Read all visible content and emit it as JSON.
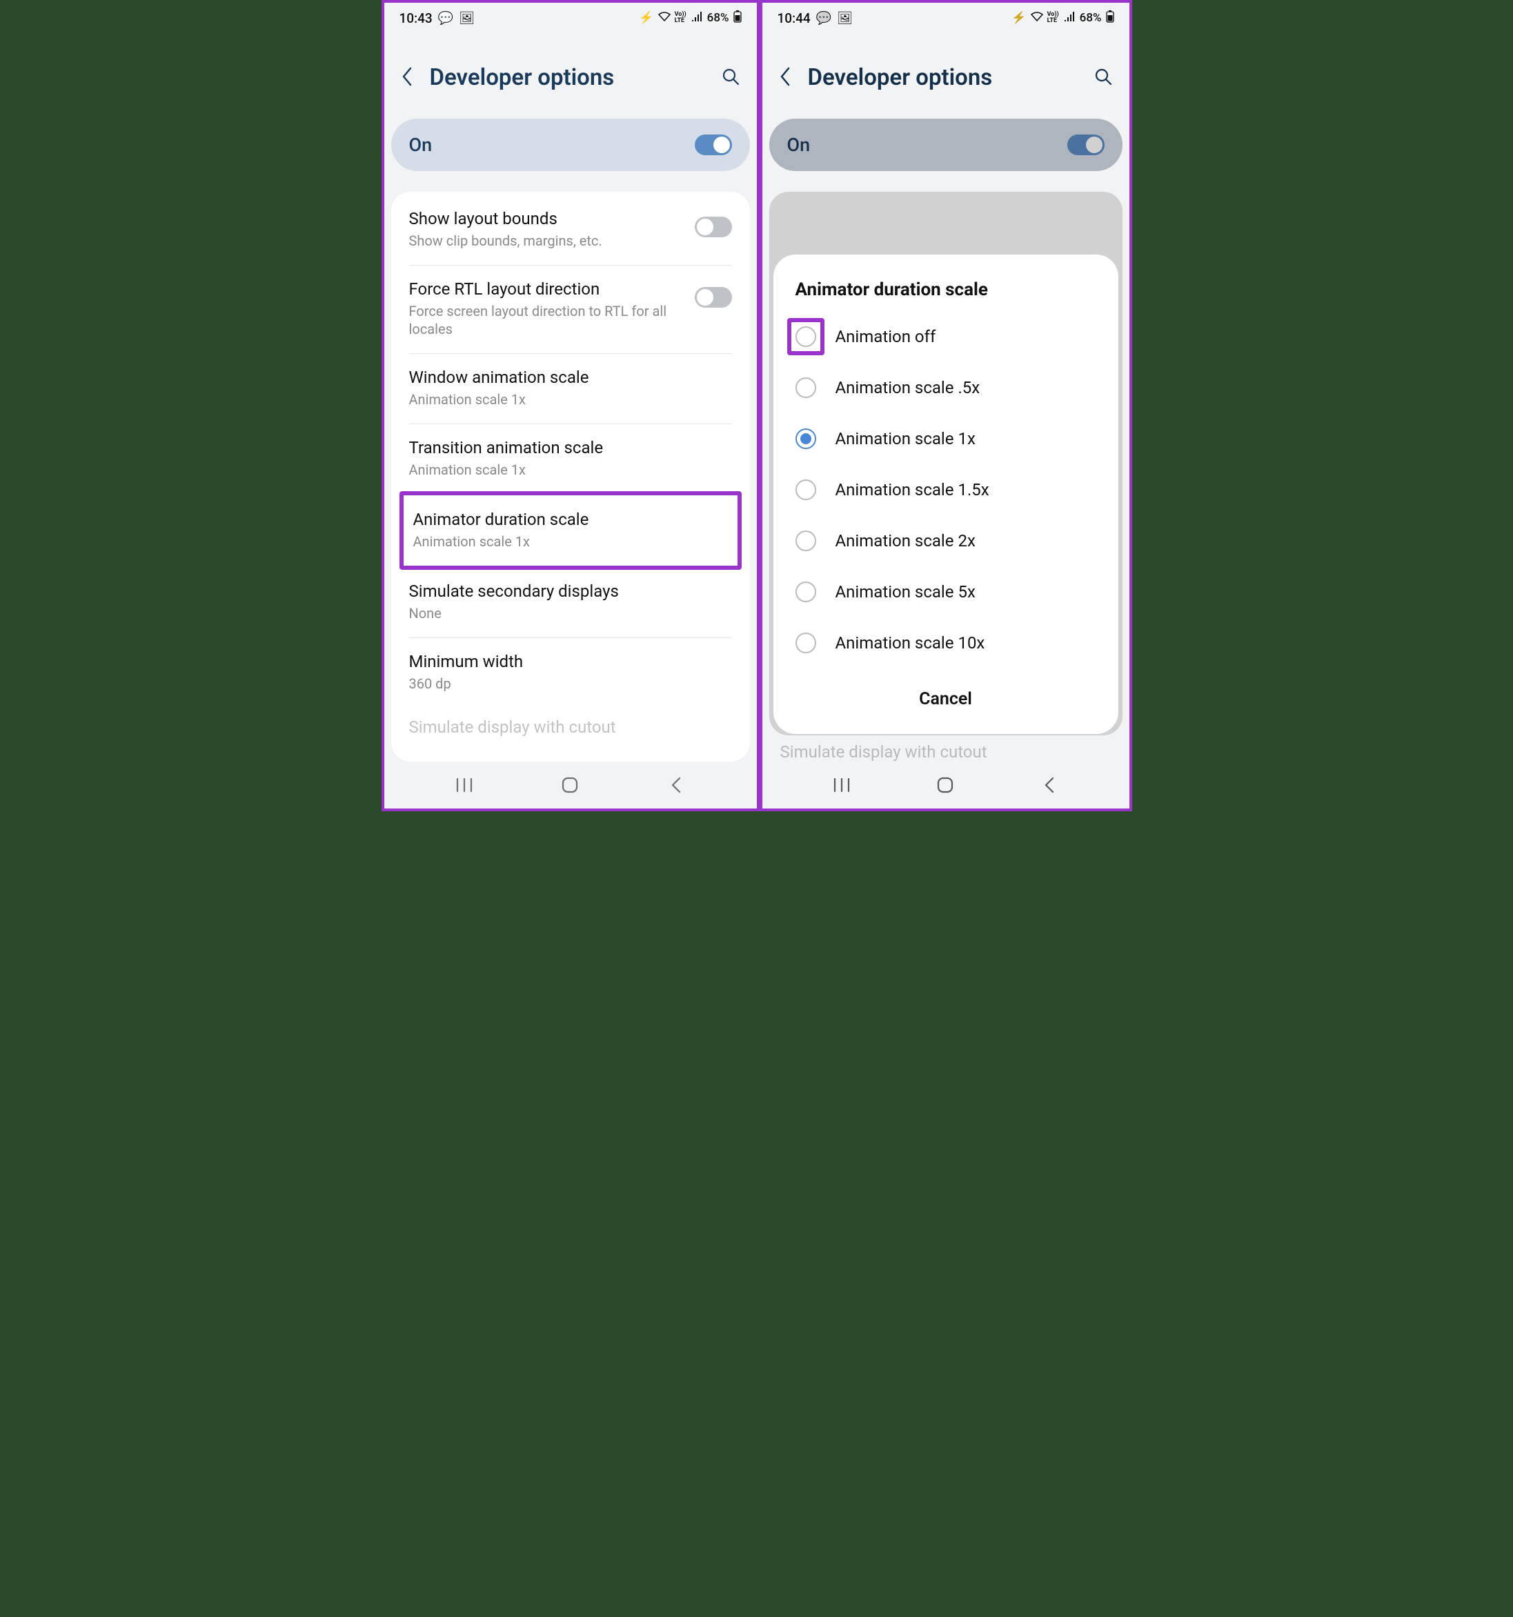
{
  "left": {
    "statusbar": {
      "time": "10:43",
      "battery": "68%"
    },
    "appbar": {
      "title": "Developer options"
    },
    "onRow": {
      "label": "On",
      "enabled": true
    },
    "rows": [
      {
        "title": "Show layout bounds",
        "sub": "Show clip bounds, margins, etc.",
        "toggle": false
      },
      {
        "title": "Force RTL layout direction",
        "sub": "Force screen layout direction to RTL for all locales",
        "toggle": false
      },
      {
        "title": "Window animation scale",
        "sub": "Animation scale 1x"
      },
      {
        "title": "Transition animation scale",
        "sub": "Animation scale 1x"
      },
      {
        "title": "Animator duration scale",
        "sub": "Animation scale 1x",
        "highlight": true
      },
      {
        "title": "Simulate secondary displays",
        "sub": "None"
      },
      {
        "title": "Minimum width",
        "sub": "360 dp"
      }
    ]
  },
  "right": {
    "statusbar": {
      "time": "10:44",
      "battery": "68%"
    },
    "appbar": {
      "title": "Developer options"
    },
    "onRow": {
      "label": "On",
      "enabled": true
    },
    "dialog": {
      "title": "Animator duration scale",
      "options": [
        {
          "label": "Animation off",
          "selected": false,
          "highlight": true
        },
        {
          "label": "Animation scale .5x",
          "selected": false
        },
        {
          "label": "Animation scale 1x",
          "selected": true
        },
        {
          "label": "Animation scale 1.5x",
          "selected": false
        },
        {
          "label": "Animation scale 2x",
          "selected": false
        },
        {
          "label": "Animation scale 5x",
          "selected": false
        },
        {
          "label": "Animation scale 10x",
          "selected": false
        }
      ],
      "cancel": "Cancel"
    }
  }
}
